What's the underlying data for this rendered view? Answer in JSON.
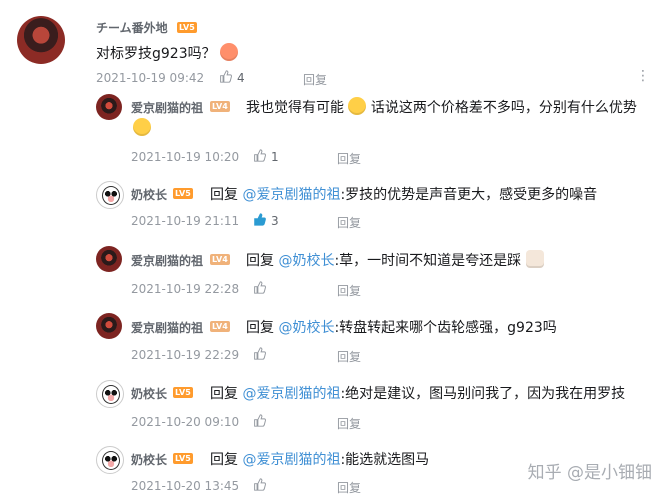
{
  "main_comment": {
    "username": "チーム番外地",
    "level": "LV5",
    "text": "对标罗技g923吗？",
    "date": "2021-10-19 09:42",
    "likes": "4",
    "reply_label": "回复",
    "more": "⋮"
  },
  "replies": [
    {
      "username": "爱京剧猫的祖",
      "level": "LV4",
      "text_line1": "我也觉得有可能",
      "text_line1_after": "话说这两个价格差不多吗，分别有什么优势",
      "date": "2021-10-19 10:20",
      "likes": "1",
      "reply_label": "回复"
    },
    {
      "username": "奶校长",
      "level": "LV5",
      "reply_word": "回复",
      "mention": "@爱京剧猫的祖",
      "text": ":罗技的优势是声音更大，感受更多的噪音",
      "date": "2021-10-19 21:11",
      "likes": "3",
      "reply_label": "回复"
    },
    {
      "username": "爱京剧猫的祖",
      "level": "LV4",
      "reply_word": "回复",
      "mention": "@奶校长",
      "text": ":草，一时间不知道是夸还是踩",
      "date": "2021-10-19 22:28",
      "reply_label": "回复"
    },
    {
      "username": "爱京剧猫的祖",
      "level": "LV4",
      "reply_word": "回复",
      "mention": "@奶校长",
      "text": ":转盘转起来哪个齿轮感强，g923吗",
      "date": "2021-10-19 22:29",
      "reply_label": "回复"
    },
    {
      "username": "奶校长",
      "level": "LV5",
      "reply_word": "回复",
      "mention": "@爱京剧猫的祖",
      "text": ":绝对是建议，图马别问我了，因为我在用罗技",
      "date": "2021-10-20 09:10",
      "reply_label": "回复"
    },
    {
      "username": "奶校长",
      "level": "LV5",
      "reply_word": "回复",
      "mention": "@爱京剧猫的祖",
      "text": ":能选就选图马",
      "date": "2021-10-20 13:45",
      "reply_label": "回复"
    }
  ],
  "watermark": "知乎 @是小钿钿",
  "colors": {
    "mention": "#3f8fd4",
    "level5": "#ff9b2d",
    "level4": "#f0b27a",
    "meta": "#9499a0",
    "liked": "#2b9bd2"
  }
}
